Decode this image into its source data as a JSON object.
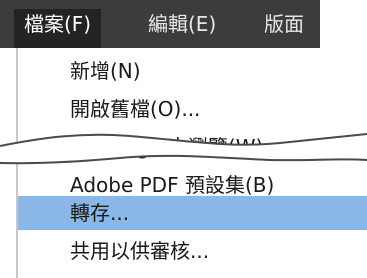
{
  "menubar": {
    "titles": [
      "檔案(F)",
      "編輯(E)",
      "版面"
    ]
  },
  "file_menu": {
    "items": [
      {
        "label": "新增(N)"
      },
      {
        "label": "開啟舊檔(O)..."
      },
      {
        "label": "在 Bridge 中瀏覽(W)..."
      },
      {
        "label": "Adobe PDF 預設集(B)"
      },
      {
        "label": "轉存..."
      },
      {
        "label": "共用以供審核..."
      }
    ],
    "selected_index": 4
  },
  "colors": {
    "menubar_bg": "#3c3c3c",
    "active_title_bg": "#232323",
    "selection": "#8ab7e6"
  }
}
